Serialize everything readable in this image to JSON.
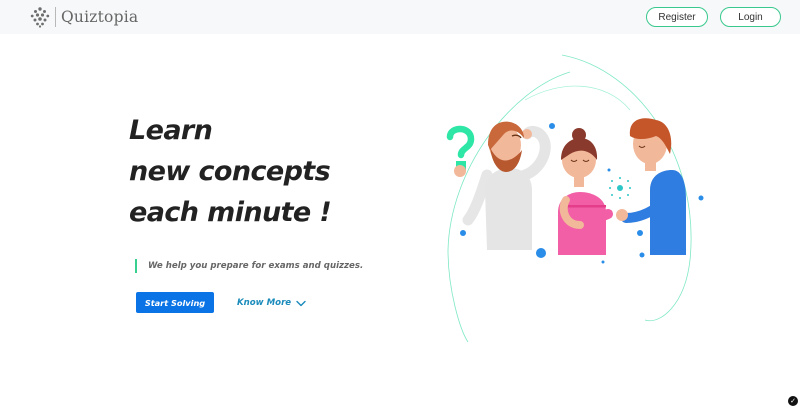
{
  "brand": {
    "name": "Quiztopia",
    "icon": "quiztopia-logo-icon"
  },
  "nav": {
    "register_label": "Register",
    "login_label": "Login"
  },
  "hero": {
    "headline_lines": [
      "Learn",
      "new concepts",
      "each minute !"
    ],
    "tagline": "We help you prepare for exams and quizzes.",
    "primary_cta": "Start Solving",
    "secondary_cta": "Know More"
  },
  "colors": {
    "accent_green": "#39c98e",
    "primary_blue": "#0a74e6",
    "link_blue": "#1a8bbb",
    "question_mark": "#2ee6a6"
  },
  "icons": {
    "know_more": "chevron-down-icon",
    "corner_badge": "cookie-consent-icon"
  }
}
